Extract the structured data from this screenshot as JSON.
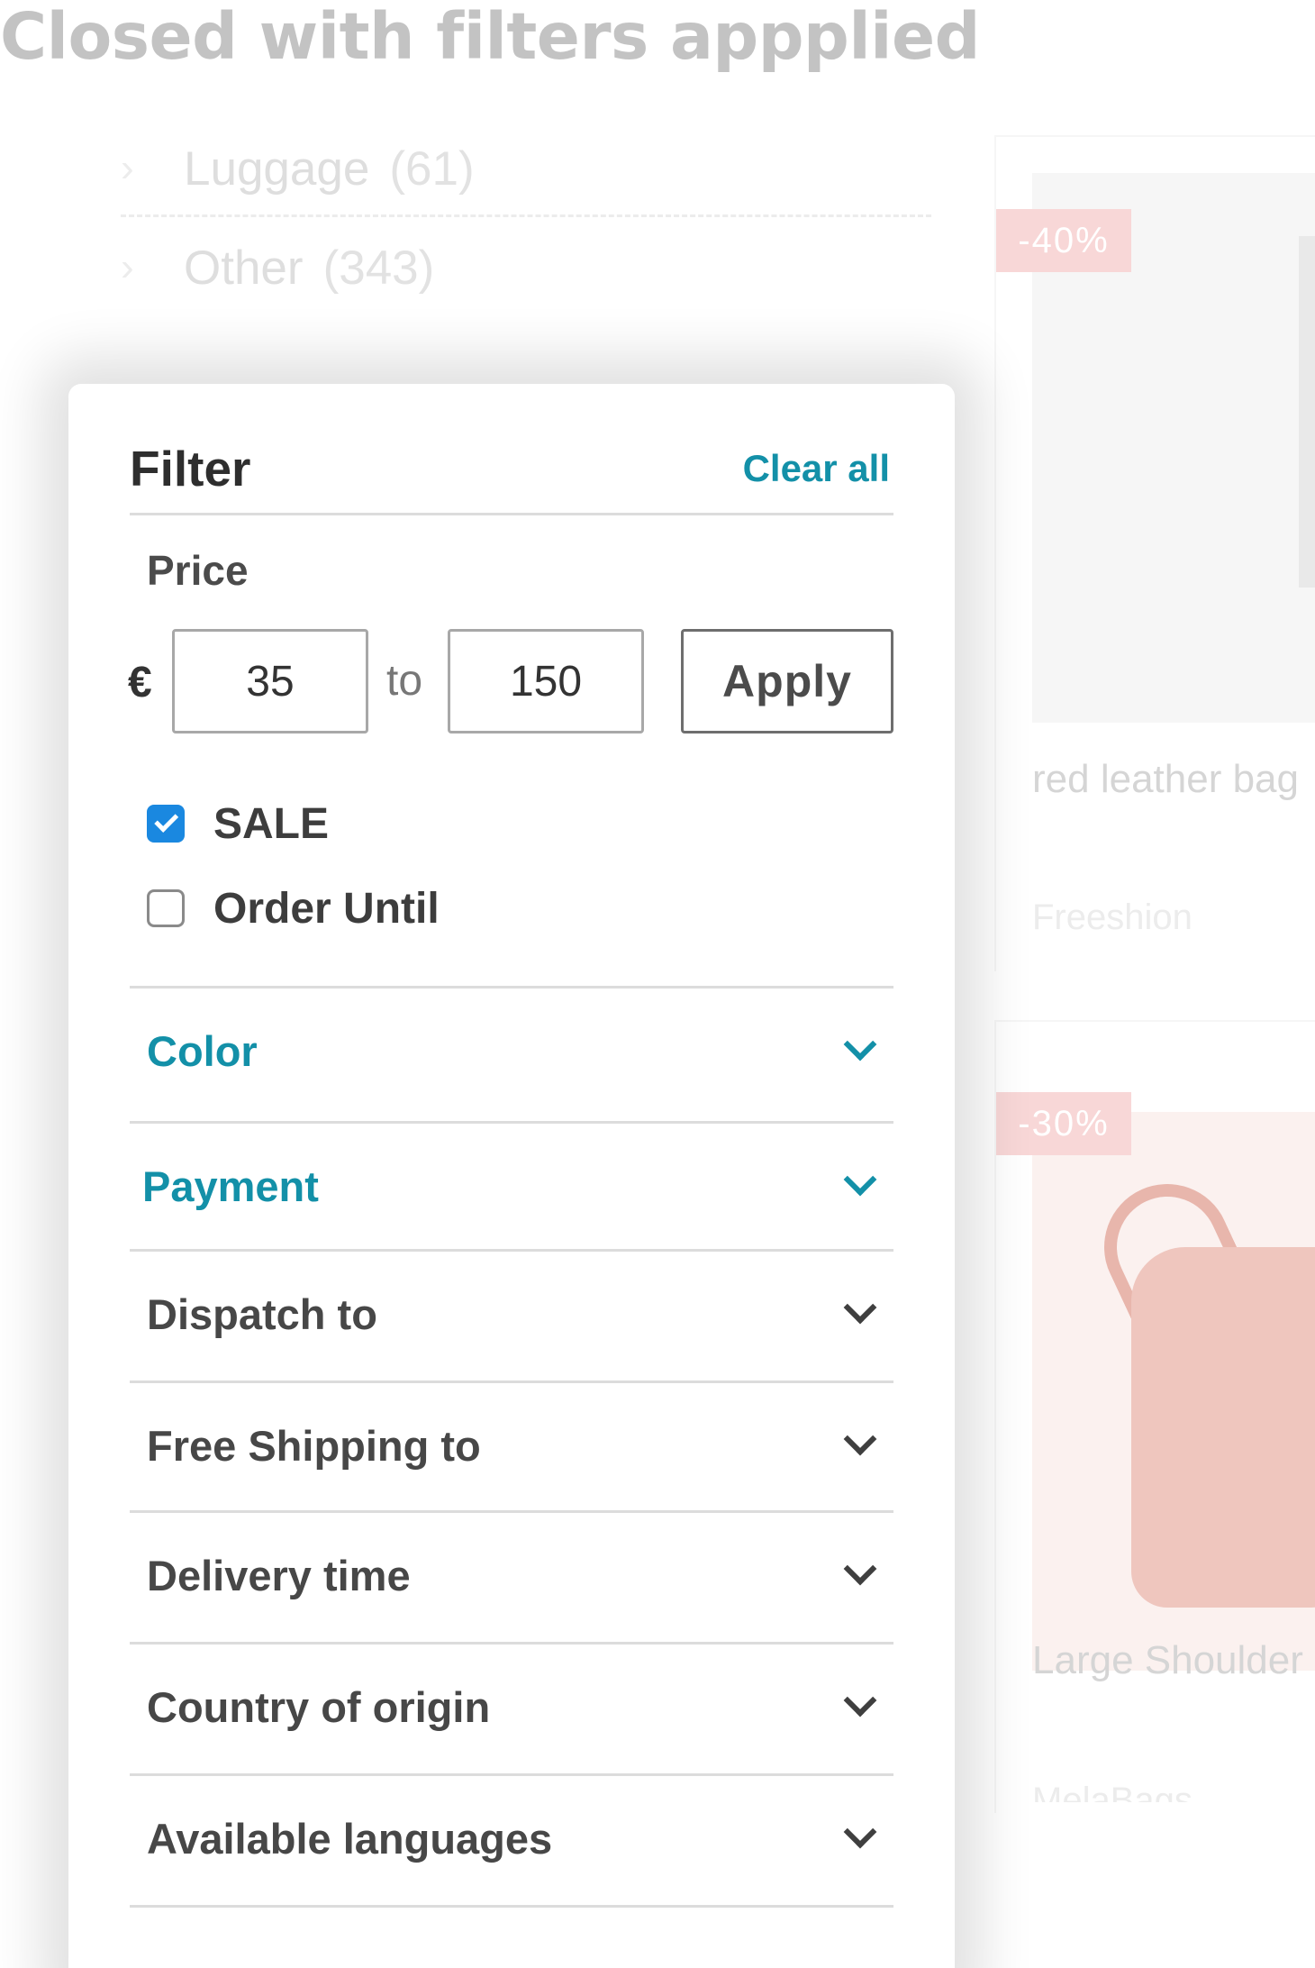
{
  "page": {
    "heading": "Closed with filters appplied"
  },
  "background": {
    "categories": [
      {
        "name": "Luggage",
        "count": "(61)"
      },
      {
        "name": "Other",
        "count": "(343)"
      }
    ],
    "products": [
      {
        "discount": "-40%",
        "name": "red leather bag",
        "brand": "Freeshion"
      },
      {
        "discount": "-30%",
        "name": "Large Shoulder",
        "brand": "MelaBags"
      }
    ]
  },
  "filter": {
    "title": "Filter",
    "clear_all": "Clear all",
    "price": {
      "label": "Price",
      "currency": "€",
      "min": "35",
      "to": "to",
      "max": "150",
      "apply": "Apply"
    },
    "checkboxes": [
      {
        "label": "SALE",
        "checked": true
      },
      {
        "label": "Order Until",
        "checked": false
      }
    ],
    "sections": [
      {
        "label": "Color",
        "active": true
      },
      {
        "label": "Payment",
        "active": true
      },
      {
        "label": "Dispatch to",
        "active": false
      },
      {
        "label": "Free Shipping to",
        "active": false
      },
      {
        "label": "Delivery time",
        "active": false
      },
      {
        "label": "Country of origin",
        "active": false
      },
      {
        "label": "Available languages",
        "active": false
      }
    ]
  },
  "colors": {
    "accent": "#1390a8",
    "checkbox": "#1a88e0",
    "badge": "#f8d7d7"
  },
  "icons": {
    "category_chevron": "chevron-right-icon",
    "section_chevron": "chevron-down-icon",
    "check": "checkmark-icon"
  }
}
